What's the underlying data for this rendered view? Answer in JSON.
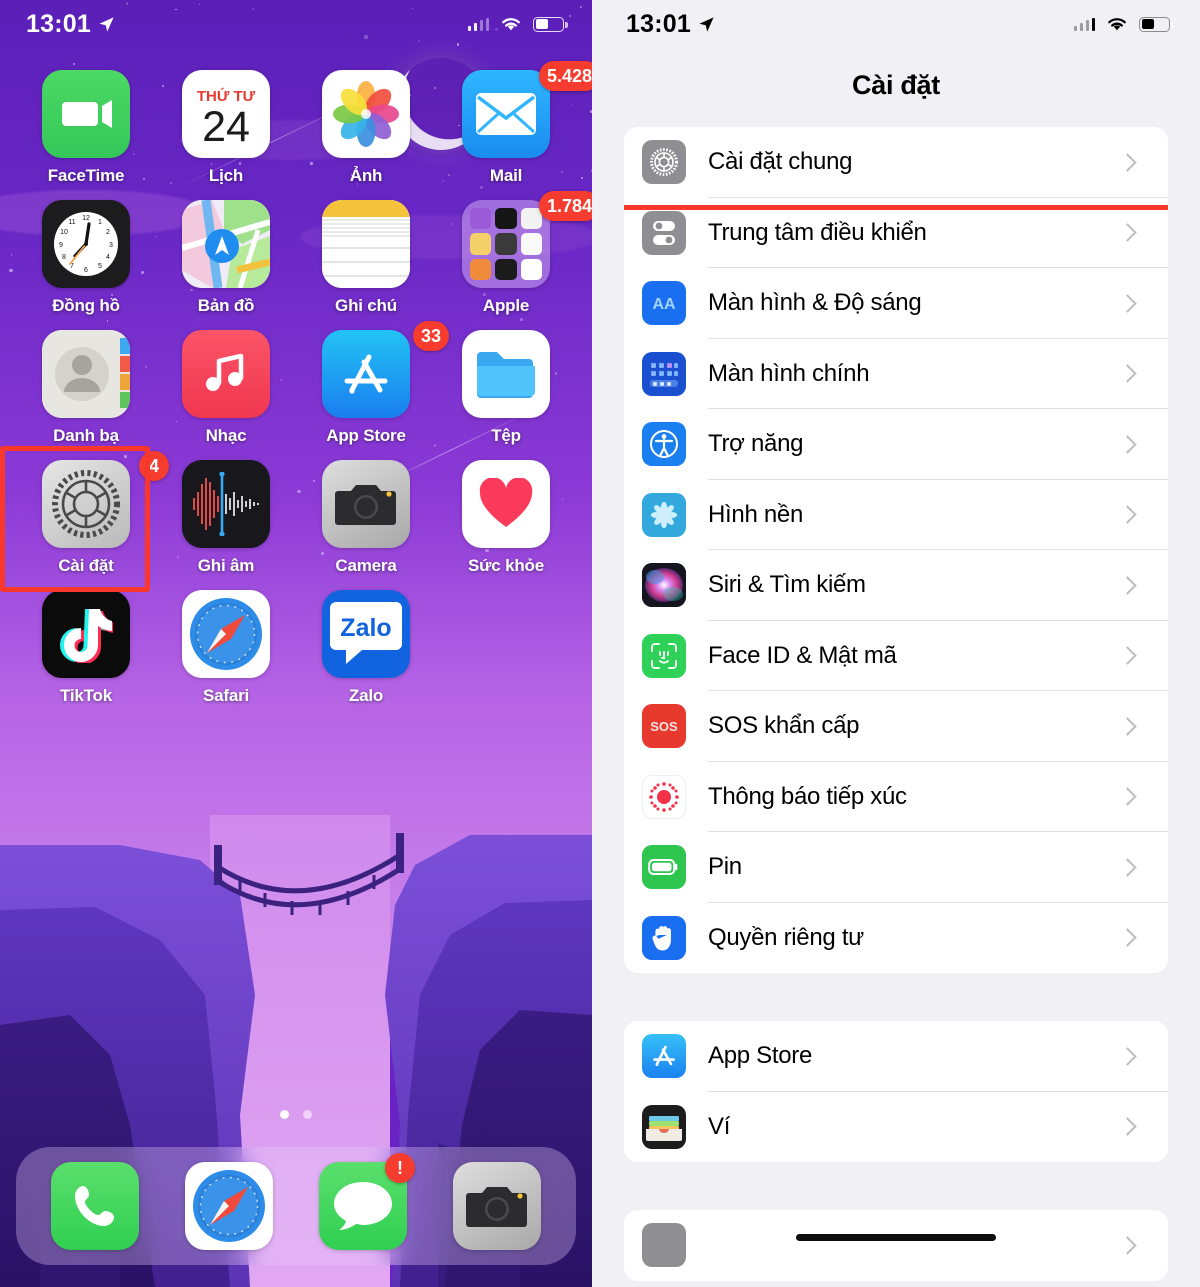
{
  "left_screen": {
    "status_bar": {
      "time": "13:01",
      "location_icon": "location-arrow-icon",
      "signal_icon": "cellular-signal-icon",
      "wifi_icon": "wifi-icon",
      "battery_icon": "battery-icon"
    },
    "apps": [
      {
        "label": "FaceTime",
        "icon": "facetime-icon",
        "badge": null
      },
      {
        "label": "Lịch",
        "icon": "calendar-icon",
        "badge": null,
        "cal_weekday": "THỨ TƯ",
        "cal_day": "24"
      },
      {
        "label": "Ảnh",
        "icon": "photos-icon",
        "badge": null
      },
      {
        "label": "Mail",
        "icon": "mail-icon",
        "badge": "5.428"
      },
      {
        "label": "Đồng hồ",
        "icon": "clock-icon",
        "badge": null
      },
      {
        "label": "Bản đồ",
        "icon": "maps-icon",
        "badge": null
      },
      {
        "label": "Ghi chú",
        "icon": "notes-icon",
        "badge": null
      },
      {
        "label": "Apple",
        "icon": "folder-apple-icon",
        "badge": "1.784"
      },
      {
        "label": "Danh bạ",
        "icon": "contacts-icon",
        "badge": null
      },
      {
        "label": "Nhạc",
        "icon": "music-icon",
        "badge": null
      },
      {
        "label": "App Store",
        "icon": "app-store-icon",
        "badge": "33"
      },
      {
        "label": "Tệp",
        "icon": "files-icon",
        "badge": null
      },
      {
        "label": "Cài đặt",
        "icon": "settings-gear-icon",
        "badge": "4",
        "highlighted": true
      },
      {
        "label": "Ghi âm",
        "icon": "voice-memos-icon",
        "badge": null
      },
      {
        "label": "Camera",
        "icon": "camera-icon",
        "badge": null
      },
      {
        "label": "Sức khỏe",
        "icon": "health-heart-icon",
        "badge": null
      },
      {
        "label": "TikTok",
        "icon": "tiktok-icon",
        "badge": null
      },
      {
        "label": "Safari",
        "icon": "safari-icon",
        "badge": null
      },
      {
        "label": "Zalo",
        "icon": "zalo-icon",
        "badge": null,
        "wordmark": "Zalo"
      }
    ],
    "dock": [
      {
        "label": "Điện thoại",
        "icon": "phone-icon",
        "badge": null
      },
      {
        "label": "Safari",
        "icon": "safari-icon",
        "badge": null
      },
      {
        "label": "Tin nhắn",
        "icon": "messages-icon",
        "badge": "!"
      },
      {
        "label": "Camera",
        "icon": "camera-icon",
        "badge": null
      }
    ],
    "page_dots": {
      "count": 2,
      "active_index": 0
    }
  },
  "right_screen": {
    "status_bar": {
      "time": "13:01",
      "location_icon": "location-arrow-icon",
      "signal_icon": "cellular-signal-icon",
      "wifi_icon": "wifi-icon",
      "battery_icon": "battery-icon"
    },
    "nav_title": "Cài đặt",
    "groups": [
      {
        "items": [
          {
            "label": "Cài đặt chung",
            "icon": "general-gear-icon",
            "highlighted": true
          },
          {
            "label": "Trung tâm điều khiển",
            "icon": "control-center-icon",
            "highlighted": false
          },
          {
            "label": "Màn hình & Độ sáng",
            "icon": "display-brightness-icon",
            "highlighted": false
          },
          {
            "label": "Màn hình chính",
            "icon": "home-screen-icon",
            "highlighted": false
          },
          {
            "label": "Trợ năng",
            "icon": "accessibility-icon",
            "highlighted": false
          },
          {
            "label": "Hình nền",
            "icon": "wallpaper-icon",
            "highlighted": false
          },
          {
            "label": "Siri & Tìm kiếm",
            "icon": "siri-icon",
            "highlighted": false
          },
          {
            "label": "Face ID & Mật mã",
            "icon": "face-id-icon",
            "highlighted": false
          },
          {
            "label": "SOS khẩn cấp",
            "icon": "sos-icon",
            "highlighted": false
          },
          {
            "label": "Thông báo tiếp xúc",
            "icon": "exposure-notification-icon",
            "highlighted": false
          },
          {
            "label": "Pin",
            "icon": "battery-settings-icon",
            "highlighted": false
          },
          {
            "label": "Quyền riêng tư",
            "icon": "privacy-hand-icon",
            "highlighted": false
          }
        ]
      },
      {
        "items": [
          {
            "label": "App Store",
            "icon": "app-store-icon",
            "highlighted": false
          },
          {
            "label": "Ví",
            "icon": "wallet-icon",
            "highlighted": false
          }
        ]
      }
    ],
    "home_indicator": "home-indicator"
  },
  "colors": {
    "highlight_red": "#f9372a",
    "badge_red": "#f63c2e",
    "list_bg": "#f1f1f5",
    "row_bg": "#ffffff",
    "separator": "#e2e2e6",
    "chevron": "#bdbdc2",
    "wallpaper_purple": "#6a22c4"
  }
}
